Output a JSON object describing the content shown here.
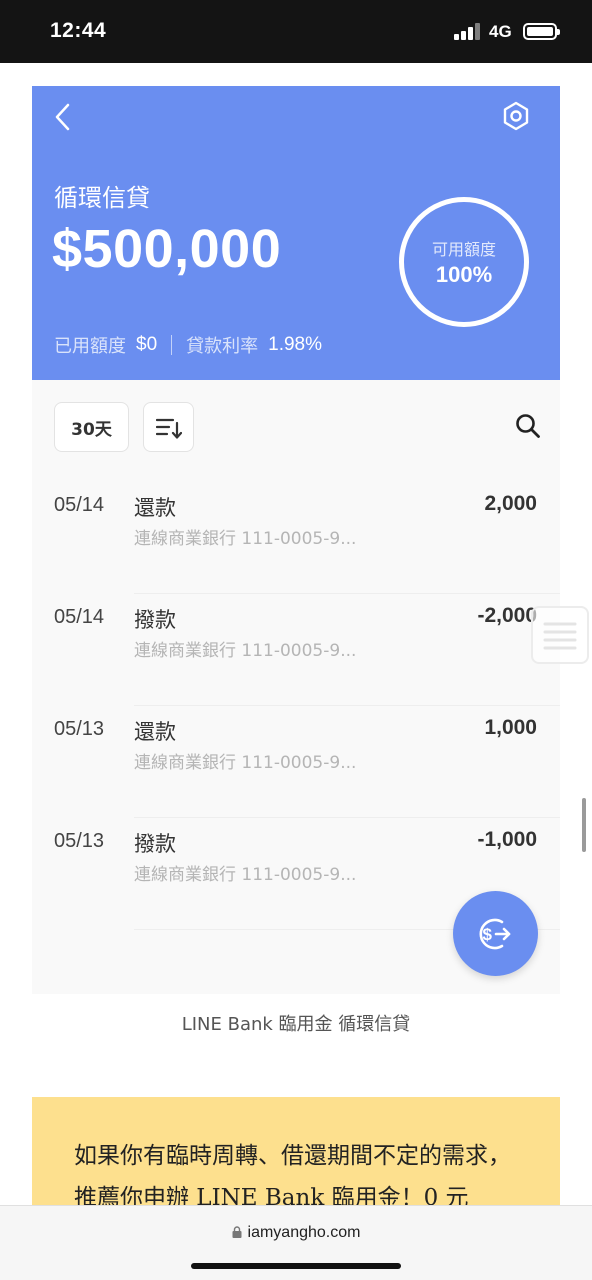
{
  "status_bar": {
    "time": "12:44",
    "network": "4G",
    "battery_level": 1.0
  },
  "header": {
    "title": "循環信貸",
    "amount": "$500,000",
    "available_label": "可用額度",
    "available_value": "100%",
    "used_label": "已用額度",
    "used_value": "$0",
    "rate_label": "貸款利率",
    "rate_value": "1.98%",
    "background_color": "#6a8ef0"
  },
  "controls": {
    "days_filter": "30天"
  },
  "transactions": [
    {
      "date": "05/14",
      "type": "還款",
      "desc": "連線商業銀行 111-0005-9...",
      "amount": "2,000"
    },
    {
      "date": "05/14",
      "type": "撥款",
      "desc": "連線商業銀行 111-0005-9...",
      "amount": "-2,000"
    },
    {
      "date": "05/13",
      "type": "還款",
      "desc": "連線商業銀行 111-0005-9...",
      "amount": "1,000"
    },
    {
      "date": "05/13",
      "type": "撥款",
      "desc": "連線商業銀行 111-0005-9...",
      "amount": "-1,000"
    }
  ],
  "caption": "LINE Bank 臨用金 循環信貸",
  "promo": {
    "text": "如果你有臨時周轉、借還期間不定的需求，推薦你申辦 LINE Bank 臨用金！0 元",
    "background_color": "#fde08e"
  },
  "browser": {
    "url": "iamyangho.com"
  }
}
